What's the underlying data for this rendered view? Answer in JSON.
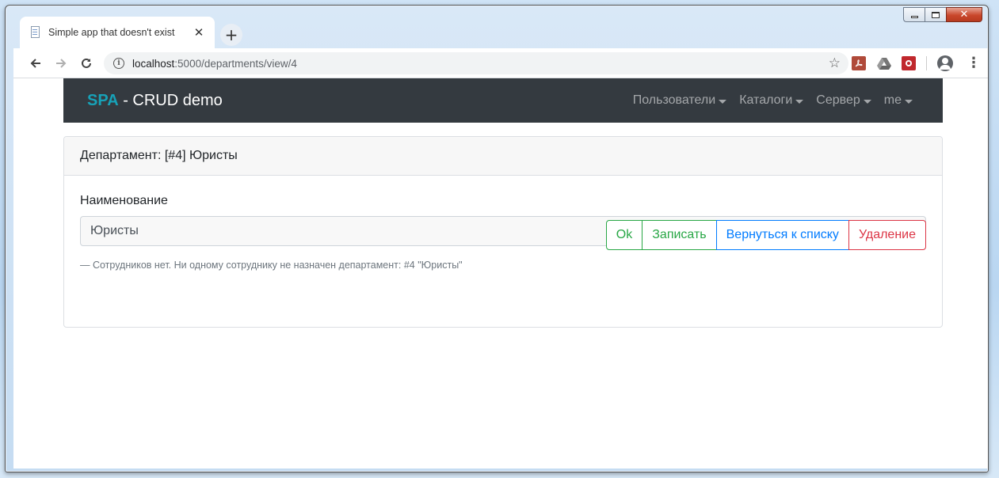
{
  "browser": {
    "tab_title": "Simple app that doesn't exist",
    "tab_close": "✕",
    "new_tab": "+",
    "url_host": "localhost",
    "url_path": ":5000/departments/view/4"
  },
  "navbar": {
    "brand_spa": "SPA",
    "brand_rest": " - CRUD demo",
    "menu": [
      {
        "label": "Пользователи"
      },
      {
        "label": "Каталоги"
      },
      {
        "label": "Сервер"
      },
      {
        "label": "me"
      }
    ]
  },
  "card": {
    "header": "Департамент: [#4] Юристы",
    "field_label": "Наименование",
    "field_value": "Юристы",
    "buttons": {
      "ok": "Ok",
      "save": "Записать",
      "back": "Вернуться к списку",
      "delete": "Удаление"
    },
    "note": "— Сотрудников нет. Ни одному сотруднику не назначен департамент: #4 \"Юристы\""
  },
  "colors": {
    "navbar_bg": "#343a40",
    "brand_accent": "#17a2b8",
    "success": "#28a745",
    "primary": "#007bff",
    "danger": "#dc3545"
  }
}
